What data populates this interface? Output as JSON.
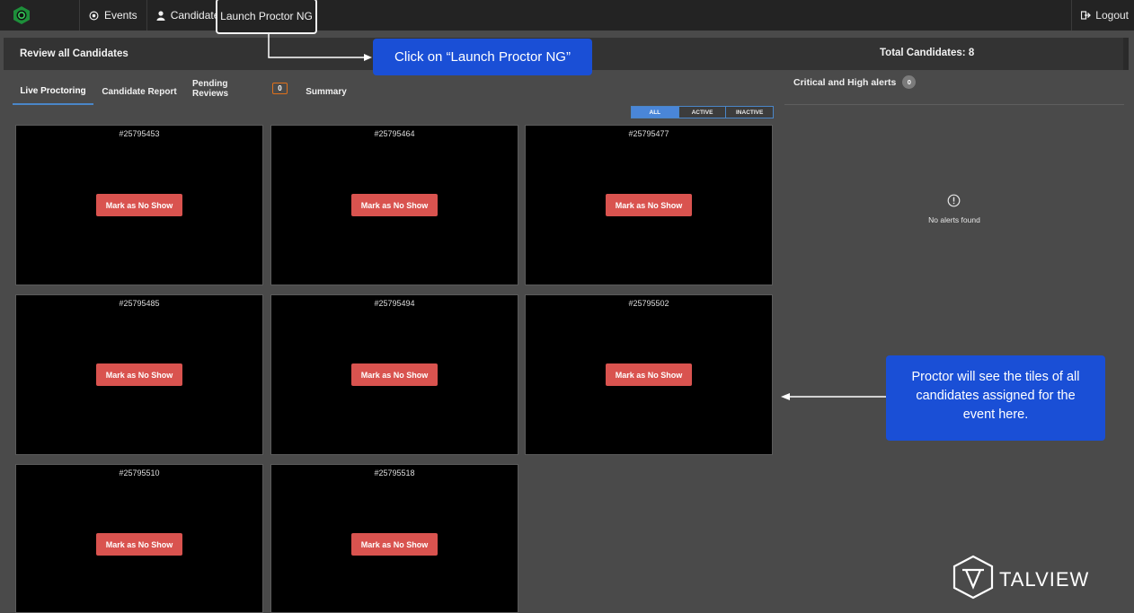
{
  "nav": {
    "events_label": "Events",
    "candidates_label": "Candidates",
    "launch_label": "Launch Proctor NG",
    "logout_label": "Logout"
  },
  "header": {
    "title": "Review all Candidates",
    "total_candidates": "Total Candidates: 8"
  },
  "tabs": [
    {
      "label": "Live Proctoring"
    },
    {
      "label": "Candidate Report"
    },
    {
      "label": "Pending Reviews",
      "badge": "0"
    },
    {
      "label": "Summary"
    }
  ],
  "filters": [
    "ALL",
    "ACTIVE",
    "INACTIVE"
  ],
  "tiles": [
    {
      "id": "#25795453",
      "action": "Mark as No Show"
    },
    {
      "id": "#25795464",
      "action": "Mark as No Show"
    },
    {
      "id": "#25795477",
      "action": "Mark as No Show"
    },
    {
      "id": "#25795485",
      "action": "Mark as No Show"
    },
    {
      "id": "#25795494",
      "action": "Mark as No Show"
    },
    {
      "id": "#25795502",
      "action": "Mark as No Show"
    },
    {
      "id": "#25795510",
      "action": "Mark as No Show"
    },
    {
      "id": "#25795518",
      "action": "Mark as No Show"
    }
  ],
  "alerts": {
    "title": "Critical and High alerts",
    "count": "0",
    "empty_text": "No alerts found"
  },
  "callouts": {
    "launch": "Click on “Launch Proctor NG”",
    "tiles": "Proctor will see the tiles of all candidates assigned for the event here."
  },
  "brand": {
    "name": "TALVIEW"
  },
  "colors": {
    "accent": "#4a86c8",
    "danger": "#d9534f",
    "callout": "#1a4fd6",
    "badge_border": "#e0701a"
  }
}
